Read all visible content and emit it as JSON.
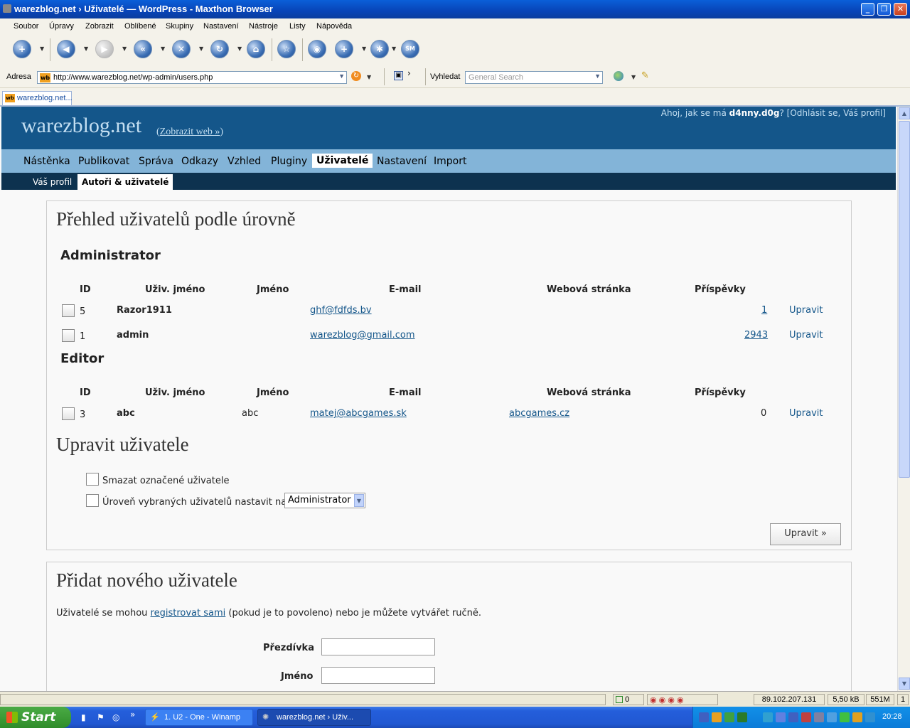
{
  "window": {
    "title": "warezblog.net › Uživatelé — WordPress - Maxthon Browser"
  },
  "menu": [
    "Soubor",
    "Úpravy",
    "Zobrazit",
    "Oblíbené",
    "Skupiny",
    "Nastavení",
    "Nástroje",
    "Listy",
    "Nápověda"
  ],
  "address": {
    "label": "Adresa",
    "url": "http://www.warezblog.net/wp-admin/users.php",
    "favicon": "wb"
  },
  "search": {
    "label": "Vyhledat",
    "placeholder": "General Search"
  },
  "tab": {
    "label": "warezblog.net..."
  },
  "wp": {
    "site_title": "warezblog.net",
    "view_site": "Zobrazit web »",
    "user_greeting": "Ahoj, jak se má",
    "user_name": "d4nny.d0g",
    "user_links": "? [Odhlásit se, Váš profil]",
    "menu": [
      "Nástěnka",
      "Publikovat",
      "Správa",
      "Odkazy",
      "Vzhled",
      "Pluginy",
      "Uživatelé",
      "Nastavení",
      "Import"
    ],
    "submenu": [
      "Váš profil",
      "Autoři & uživatelé"
    ],
    "overview_title": "Přehled uživatelů podle úrovně",
    "columns": [
      "ID",
      "Uživ. jméno",
      "Jméno",
      "E-mail",
      "Webová stránka",
      "Příspěvky"
    ],
    "groups": [
      {
        "role": "Administrator",
        "rows": [
          {
            "id": "5",
            "login": "Razor1911",
            "name": "",
            "email": "ghf@fdfds.bv",
            "web": "",
            "posts": "1",
            "edit": "Upravit"
          },
          {
            "id": "1",
            "login": "admin",
            "name": "",
            "email": "warezblog@gmail.com",
            "web": "",
            "posts": "2943",
            "edit": "Upravit"
          }
        ]
      },
      {
        "role": "Editor",
        "rows": [
          {
            "id": "3",
            "login": "abc",
            "name": "abc",
            "email": "matej@abcgames.sk",
            "web": "abcgames.cz",
            "posts": "0",
            "edit": "Upravit"
          }
        ]
      }
    ],
    "edit_title": "Upravit uživatele",
    "delete_option": "Smazat označené uživatele",
    "level_option": "Úroveň vybraných uživatelů nastavit na:",
    "level_value": "Administrator",
    "update_button": "Upravit »",
    "add_title": "Přidat nového uživatele",
    "add_text_1": "Uživatelé se mohou",
    "add_link": "registrovat sami",
    "add_text_2": "(pokud je to povoleno) nebo je můžete vytvářet ručně.",
    "field_nick": "Přezdívka",
    "field_name": "Jméno"
  },
  "status": {
    "zero": "0",
    "ip": "89.102.207.131",
    "size": "5,50 kB",
    "mem": "551M",
    "page": "1"
  },
  "taskbar": {
    "start": "Start",
    "tasks": [
      "1. U2 - One - Winamp",
      "warezblog.net › Uživ..."
    ],
    "clock": "20:28"
  }
}
